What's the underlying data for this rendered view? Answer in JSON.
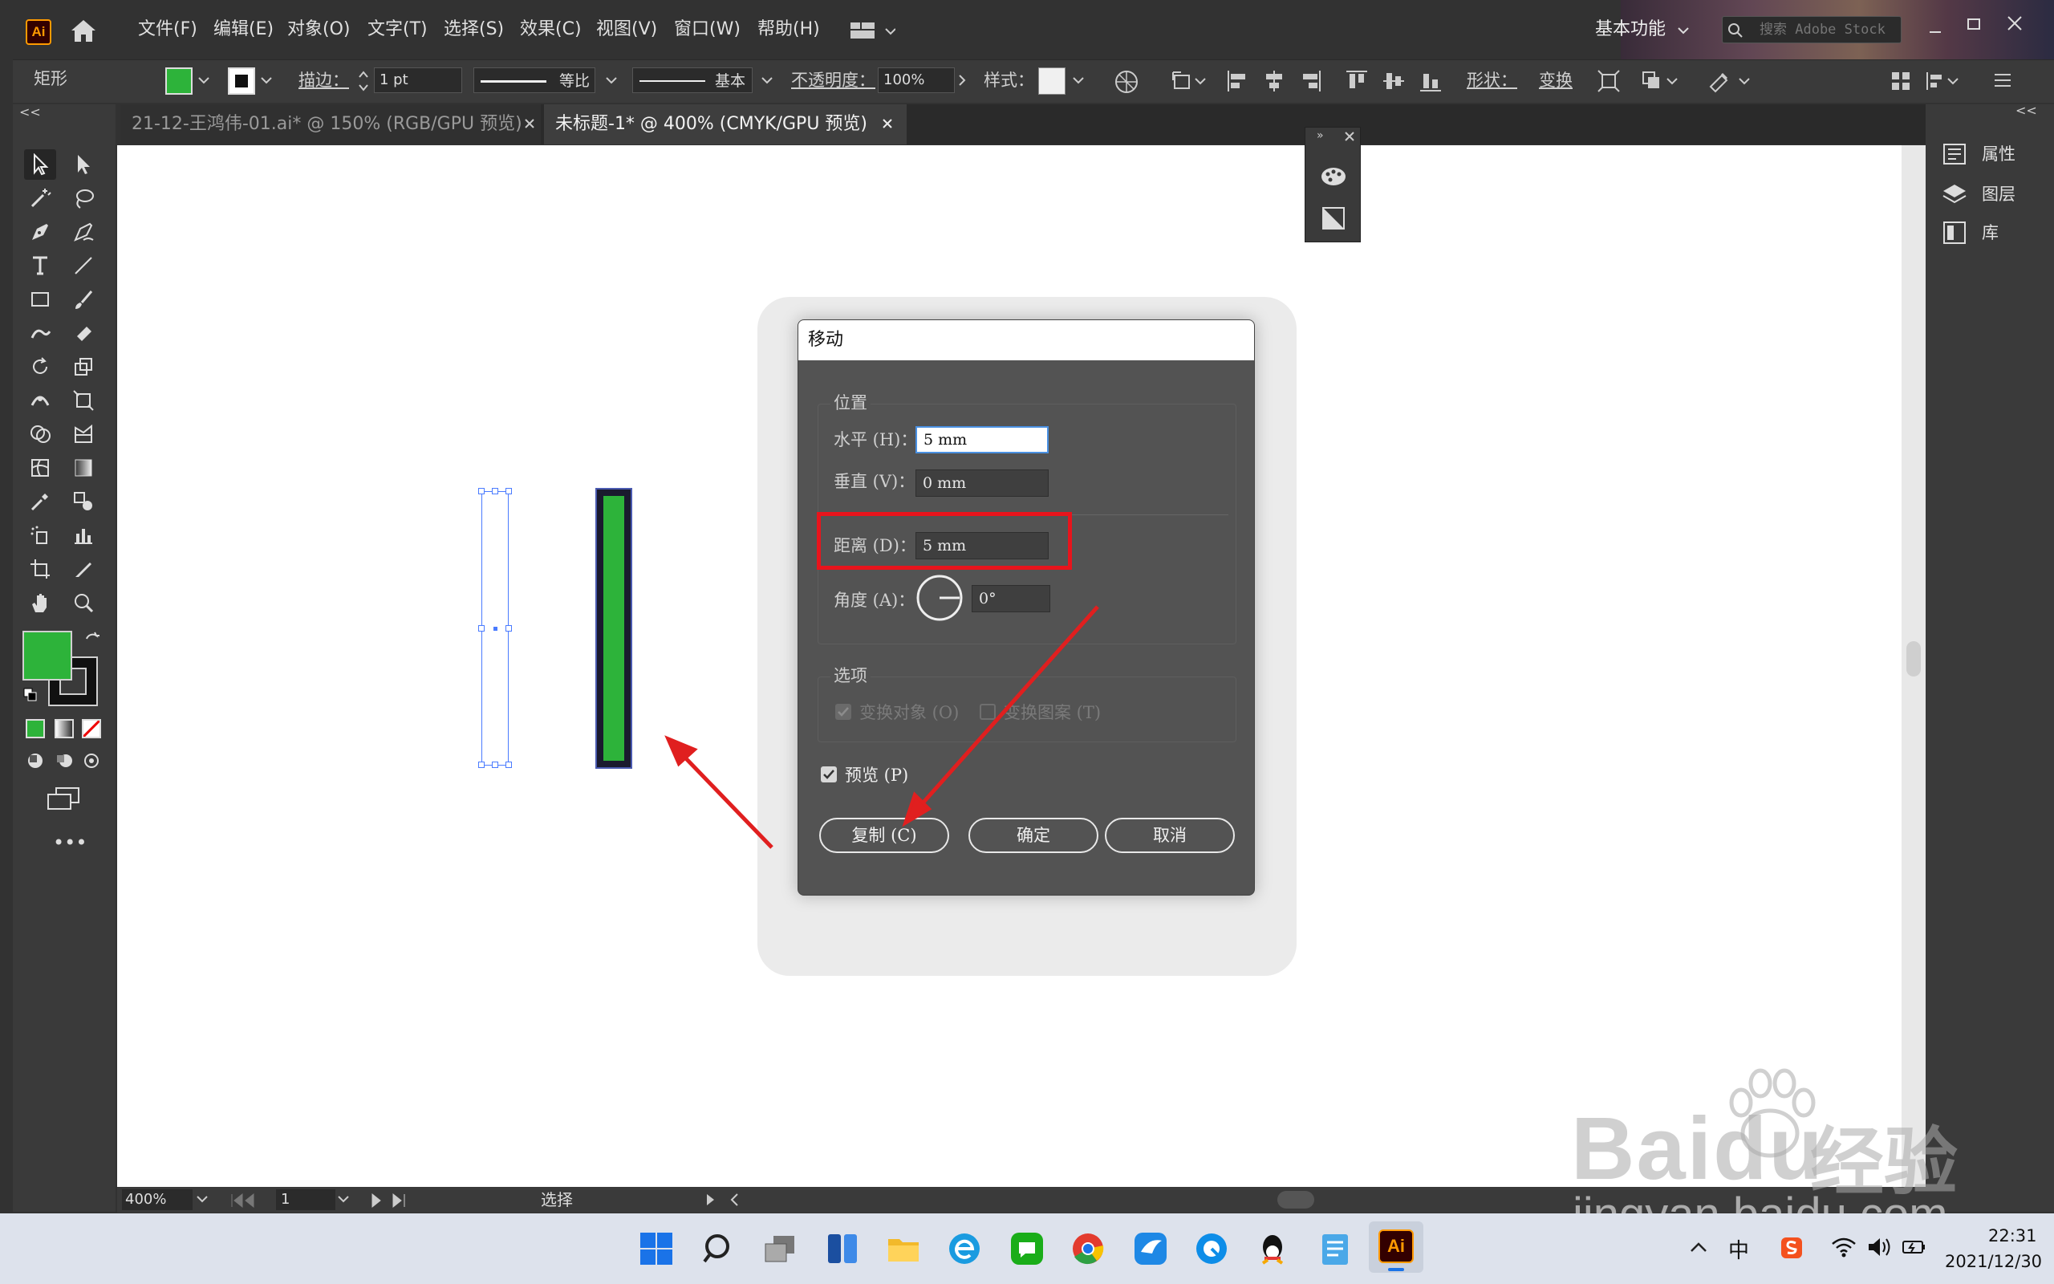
{
  "app": {
    "logo_text": "Ai",
    "menu": [
      "文件(F)",
      "编辑(E)",
      "对象(O)",
      "文字(T)",
      "选择(S)",
      "效果(C)",
      "视图(V)",
      "窗口(W)",
      "帮助(H)"
    ],
    "workspace": "基本功能",
    "search_placeholder": "搜索 Adobe Stock"
  },
  "control_bar": {
    "object_type": "矩形",
    "fill_color": "#2db33a",
    "stroke_label": "描边：",
    "stroke_weight": "1 pt",
    "stroke_profile": "等比",
    "brush": "基本",
    "opacity_label": "不透明度：",
    "opacity": "100%",
    "style_label": "样式：",
    "shape_label": "形状：",
    "transform_label": "变换"
  },
  "tabs": [
    {
      "label": "21-12-王鸿伟-01.ai* @ 150% (RGB/GPU 预览)",
      "active": false
    },
    {
      "label": "未标题-1* @ 400% (CMYK/GPU 预览)",
      "active": true
    }
  ],
  "right_panel": {
    "items": [
      "属性",
      "图层",
      "库"
    ]
  },
  "dialog": {
    "title": "移动",
    "position_group": "位置",
    "horizontal_label": "水平 (H)：",
    "horizontal_value": "5 mm",
    "vertical_label": "垂直 (V)：",
    "vertical_value": "0 mm",
    "distance_label": "距离 (D)：",
    "distance_value": "5 mm",
    "angle_label": "角度 (A)：",
    "angle_value": "0°",
    "options_group": "选项",
    "transform_objects": "变换对象 (O)",
    "transform_patterns": "变换图案 (T)",
    "preview_label": "预览 (P)",
    "preview_checked": true,
    "copy_button": "复制 (C)",
    "ok_button": "确定",
    "cancel_button": "取消"
  },
  "status_bar": {
    "zoom": "400%",
    "artboard": "1",
    "tool": "选择"
  },
  "taskbar": {
    "time": "22:31",
    "date": "2021/12/30",
    "ime": "中"
  },
  "watermark": {
    "brand": "Baidu",
    "brand_cn": "经验",
    "url": "jingyan.baidu.com"
  },
  "colors": {
    "highlight_red": "#e8141c",
    "arrow_red": "#e01f1f",
    "green_rect": "#2db33a",
    "selection_blue": "#4a7bff"
  }
}
